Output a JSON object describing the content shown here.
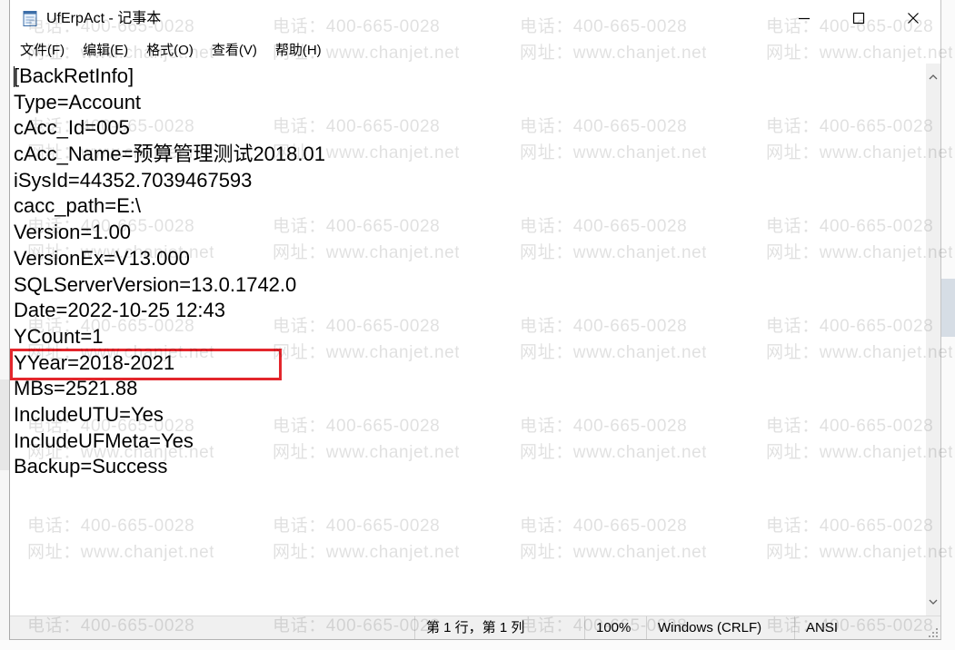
{
  "window": {
    "title": "UfErpAct - 记事本",
    "icon": "notepad-icon",
    "controls": {
      "minimize": "minimize-icon",
      "maximize": "maximize-icon",
      "close": "close-icon"
    }
  },
  "menu": {
    "items": [
      {
        "label": "文件(F)"
      },
      {
        "label": "编辑(E)"
      },
      {
        "label": "格式(O)"
      },
      {
        "label": "查看(V)"
      },
      {
        "label": "帮助(H)"
      }
    ]
  },
  "editor": {
    "lines": [
      "[BackRetInfo]",
      "Type=Account",
      "cAcc_Id=005",
      "cAcc_Name=预算管理测试2018.01",
      "iSysId=44352.7039467593",
      "cacc_path=E:\\",
      "Version=1.00",
      "VersionEx=V13.000",
      "SQLServerVersion=13.0.1742.0",
      "Date=2022-10-25 12:43",
      "YCount=1",
      "YYear=2018-2021",
      "MBs=2521.88",
      "IncludeUTU=Yes",
      "IncludeUFMeta=Yes",
      "Backup=Success"
    ]
  },
  "scrollbar": {
    "up_icon": "chevron-up-icon",
    "down_icon": "chevron-down-icon"
  },
  "status_bar": {
    "position": "第 1 行，第 1 列",
    "zoom": "100%",
    "line_ending": "Windows (CRLF)",
    "encoding": "ANSI"
  },
  "watermark": {
    "phone": "电话：400-665-0028",
    "site": "网址：www.chanjet.net"
  },
  "colors": {
    "highlight_box": "#e3262c",
    "status_bar_bg": "#f0f0f0",
    "text": "#000000"
  }
}
